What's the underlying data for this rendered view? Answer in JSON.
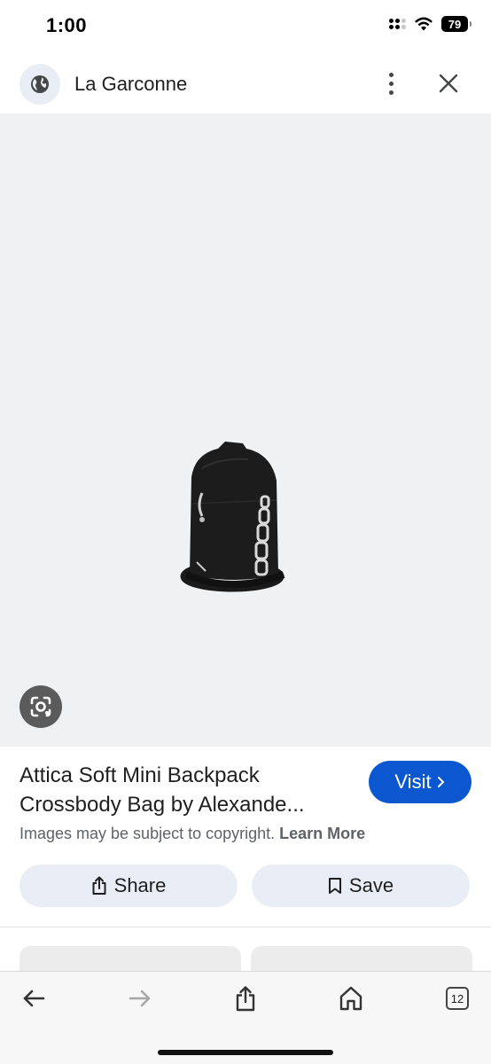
{
  "status_bar": {
    "time": "1:00",
    "battery": "79",
    "icons": [
      "signal-icon",
      "wifi-icon",
      "battery-icon"
    ]
  },
  "header": {
    "site_name": "La Garconne",
    "icons": [
      "globe-icon",
      "more-vert-icon",
      "close-icon"
    ]
  },
  "product": {
    "title": "Attica Soft Mini Backpack Crossbody Bag by Alexande...",
    "image_alt": "black mini backpack with silver chain"
  },
  "visit_button": {
    "label": "Visit",
    "icon": "chevron-right-icon"
  },
  "copyright": {
    "text": "Images may be subject to copyright.",
    "link": "Learn More"
  },
  "actions": {
    "share_label": "Share",
    "save_label": "Save"
  },
  "toolbar": {
    "tab_count": "12",
    "icons": [
      "back-arrow-icon",
      "forward-arrow-icon",
      "share-icon",
      "home-icon",
      "tabs-icon"
    ]
  },
  "colors": {
    "accent": "#0b57d0",
    "pill_bg": "#e9eef6",
    "image_bg": "#f0f1f3"
  }
}
